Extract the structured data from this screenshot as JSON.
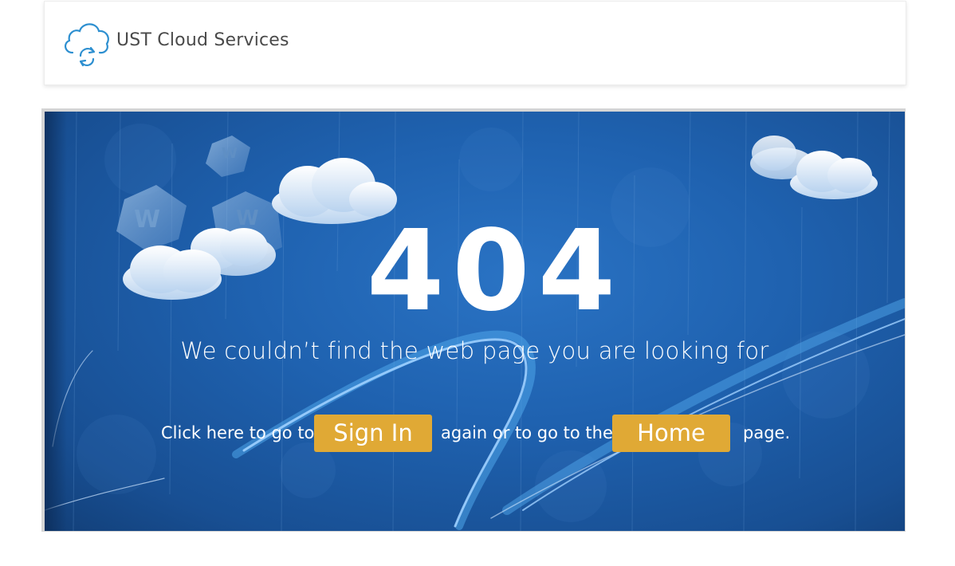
{
  "header": {
    "brand_name": "UST Cloud Services",
    "logo_icon": "cloud-sync-icon",
    "logo_color": "#2d8fd0"
  },
  "banner": {
    "error_code": "404",
    "headline": "We couldn’t find the web page you are looking for",
    "action_prefix": "Click here to go to",
    "signin_label": "Sign In",
    "action_middle": "again or to go to the",
    "home_label": "Home",
    "action_suffix": "page.",
    "button_color": "#e0a935",
    "background_color": "#1f62b0"
  }
}
